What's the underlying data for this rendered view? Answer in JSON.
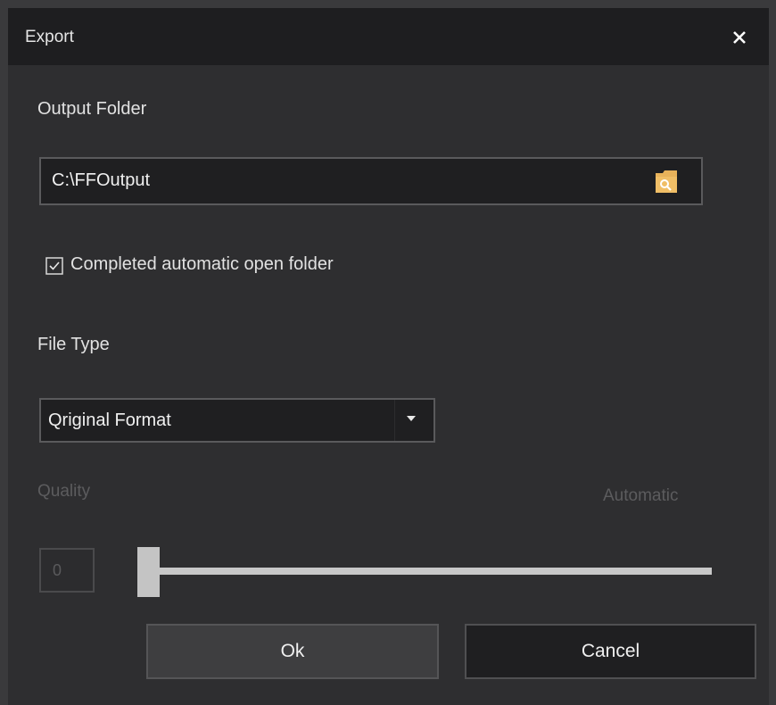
{
  "dialog": {
    "title": "Export",
    "close_icon": "close-icon"
  },
  "output": {
    "label": "Output Folder",
    "path": "C:\\FFOutput",
    "browse_icon": "folder-search-icon"
  },
  "auto_open": {
    "label": "Completed automatic open folder",
    "checked": true
  },
  "file_type": {
    "label": "File Type",
    "selected": "Qriginal Format"
  },
  "quality": {
    "label": "Quality",
    "mode_label": "Automatic",
    "value": "0",
    "slider_level": 0,
    "enabled": false
  },
  "buttons": {
    "ok": "Ok",
    "cancel": "Cancel"
  },
  "colors": {
    "background": "#2e2e30",
    "titlebar": "#1e1e20",
    "folder_icon": "#e8b25a",
    "disabled_text": "#5c5c5e"
  }
}
